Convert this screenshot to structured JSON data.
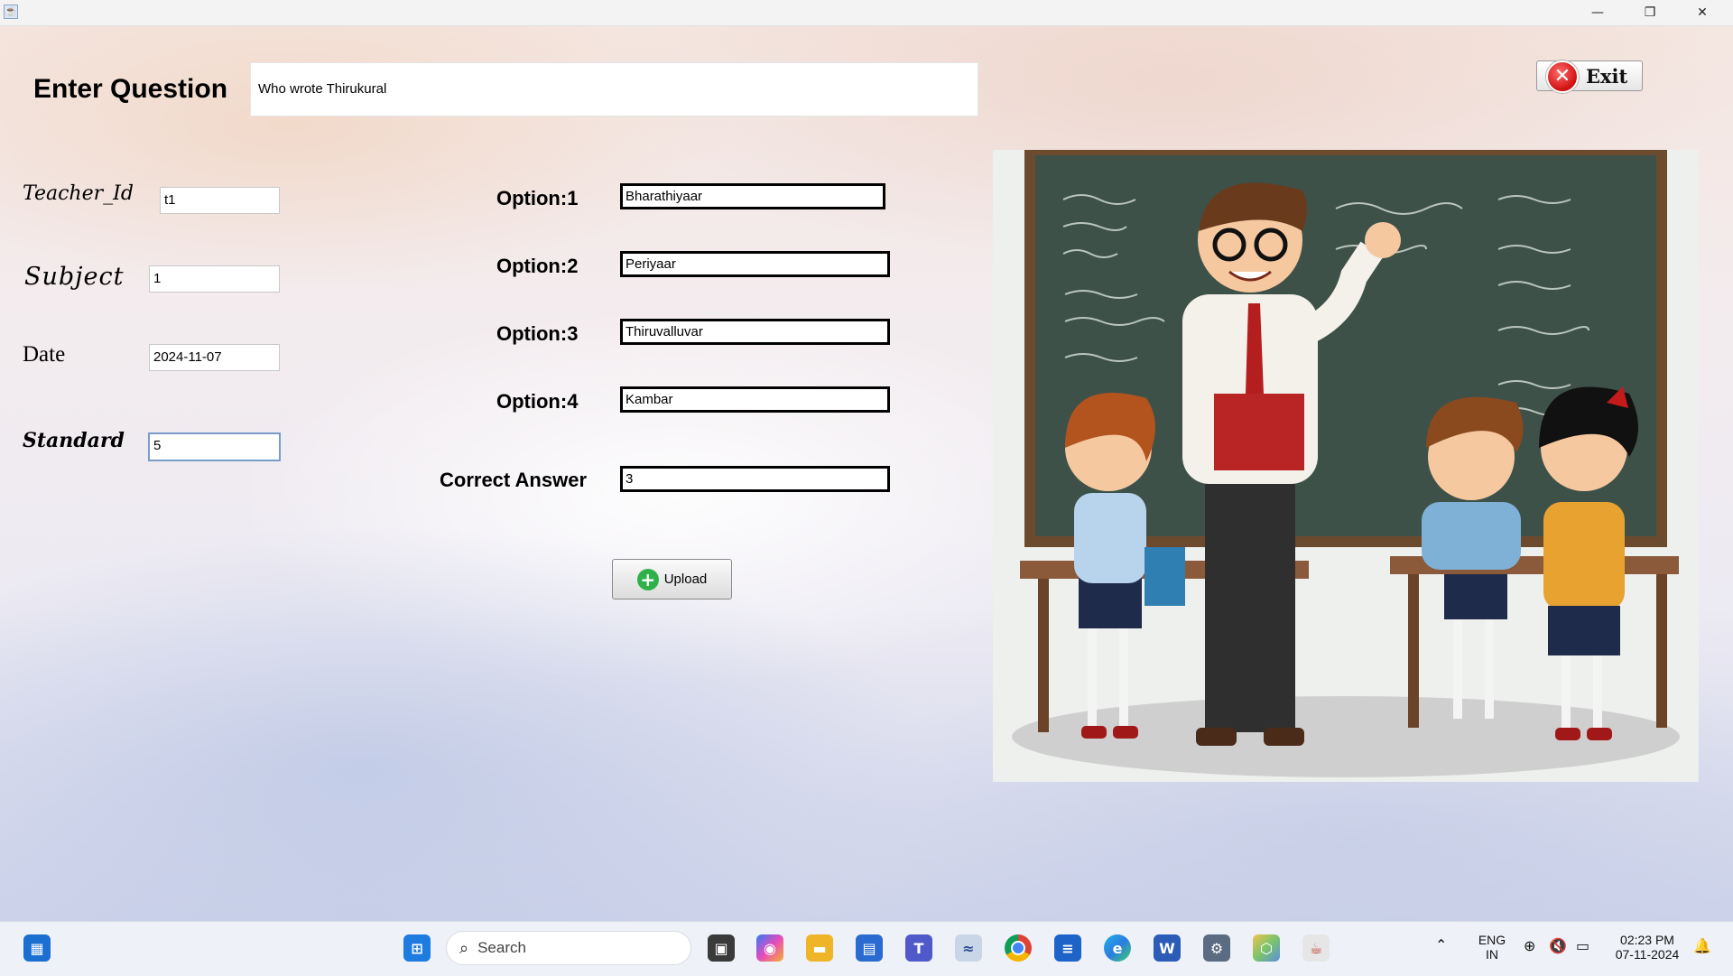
{
  "window": {
    "minimize_glyph": "—",
    "restore_glyph": "❐",
    "close_glyph": "✕"
  },
  "form": {
    "heading": "Enter Question",
    "question_value": "Who wrote Thirukural",
    "exit_label": "Exit",
    "teacher_id_label": "Teacher_Id",
    "teacher_id_value": "t1",
    "subject_label": "Subject",
    "subject_value": "1",
    "date_label": "Date",
    "date_value": "2024-11-07",
    "standard_label": "Standard",
    "standard_value": "5",
    "options": [
      {
        "label": "Option:1",
        "value": "Bharathiyaar"
      },
      {
        "label": "Option:2",
        "value": "Periyaar"
      },
      {
        "label": "Option:3",
        "value": "Thiruvalluvar"
      },
      {
        "label": "Option:4",
        "value": "Kambar"
      }
    ],
    "correct_answer_label": "Correct Answer",
    "correct_answer_value": "3",
    "upload_label": "Upload"
  },
  "illustration": {
    "icon": "classroom-teacher-students-illustration"
  },
  "taskbar": {
    "search_placeholder": "Search",
    "language_line1": "ENG",
    "language_line2": "IN",
    "time": "02:23 PM",
    "date": "07-11-2024",
    "apps": [
      "start-icon",
      "task-view-icon",
      "copilot-icon",
      "file-explorer-icon",
      "store-icon",
      "teams-icon",
      "stocks-icon",
      "chrome-icon",
      "notepad-icon",
      "edge-icon",
      "word-icon",
      "settings-icon",
      "unknown-app-icon",
      "java-icon"
    ]
  },
  "colors": {
    "taskbar_bg": "#eef1f7",
    "chalkboard": "#3e5149",
    "upload_icon": "#2fb14a",
    "exit_icon": "#d01010"
  }
}
